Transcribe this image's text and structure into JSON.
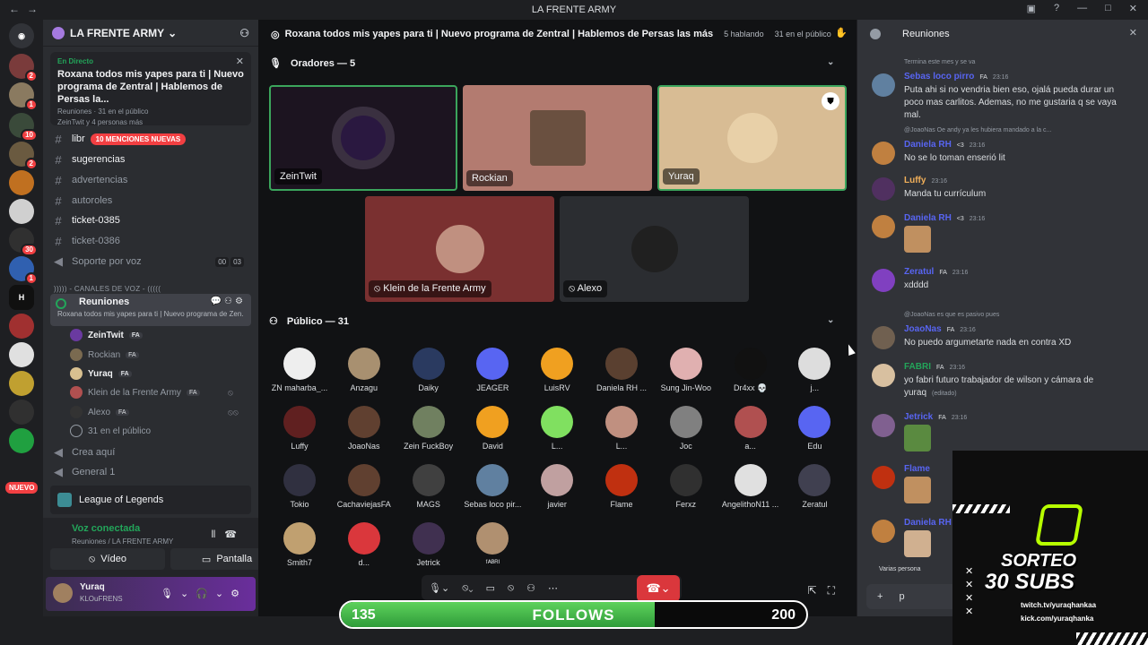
{
  "window": {
    "title": "LA FRENTE ARMY"
  },
  "server": {
    "name": "LA FRENTE ARMY"
  },
  "live_card": {
    "tag": "En Directo",
    "title": "Roxana todos mis yapes para ti | Nuevo programa de Zentral | Hablemos de Persas la...",
    "meta": "Reuniones · 31 en el público",
    "meta2": "ZeinTwit y 4 personas más"
  },
  "channels": [
    {
      "name": "libr",
      "badge": "10 MENCIONES NUEVAS"
    },
    {
      "name": "sugerencias"
    },
    {
      "name": "advertencias"
    },
    {
      "name": "autoroles"
    },
    {
      "name": "ticket-0385"
    },
    {
      "name": "ticket-0386"
    },
    {
      "name": "Soporte por voz",
      "c1": "00",
      "c2": "03"
    }
  ],
  "voice_category": "))))) - CANALES DE VOZ - (((((",
  "voice_room": {
    "name": "Reuniones",
    "desc": "Roxana todos mis yapes para ti | Nuevo programa de Zen..."
  },
  "voice_users": [
    {
      "name": "ZeinTwit",
      "fa": "FA"
    },
    {
      "name": "Rockian",
      "fa": "FA"
    },
    {
      "name": "Yuraq",
      "fa": "FA"
    },
    {
      "name": "Klein de la Frente Army",
      "fa": "FA"
    },
    {
      "name": "Alexo",
      "fa": "FA"
    },
    {
      "name": "31 en el público"
    }
  ],
  "extra_channels": [
    {
      "name": "Crea aquí"
    },
    {
      "name": "General 1"
    }
  ],
  "game": {
    "name": "League of Legends"
  },
  "voice_connected": {
    "status": "Voz conectada",
    "sub": "Reuniones / LA FRENTE ARMY",
    "video": "Vídeo",
    "screen": "Pantalla"
  },
  "user": {
    "name": "Yuraq",
    "status": "KLOuFRENS"
  },
  "nuevo": "NUEVO",
  "stage": {
    "title": "Roxana todos mis yapes para ti | Nuevo programa de Zentral | Hablemos de Persas las más",
    "speaking": "5 hablando",
    "audience_count": "31 en el público",
    "speakers_header": "Oradores — 5",
    "audience_header": "Público — 31",
    "speakers": [
      {
        "name": "ZeinTwit"
      },
      {
        "name": "Rockian"
      },
      {
        "name": "Yuraq"
      },
      {
        "name": "Klein de la Frente Army"
      },
      {
        "name": "Alexo"
      }
    ],
    "audience": [
      "ZN maharba_...",
      "Anzagu",
      "Daiky",
      "JEAGER",
      "LuisRV",
      "Daniela RH ...",
      "Sung Jin-Woo",
      "Dr4xx 💀",
      "j...",
      "Luffy",
      "JoaoNas",
      "Zein FuckBoy",
      "David",
      "L...",
      "L...",
      "Joc",
      "a...",
      "Edu",
      "Tokio",
      "CachaviejasFA",
      "MAGS",
      "Sebas loco pir...",
      "javier",
      "Flame",
      "Ferxz",
      "AngelithoN11 ...",
      "Zeratul",
      "Smith7",
      "d...",
      "Jetrick",
      "ᶠᴬᴮᴿᴵ"
    ]
  },
  "follows": {
    "current": "135",
    "label": "FOLLOWS",
    "goal": "200",
    "progress": 0.675
  },
  "chat": {
    "title": "Reuniones",
    "input": "p",
    "typing": "Varias persona",
    "messages": [
      {
        "reply": "Termina este mes y se va",
        "author": "Sebas loco pirro",
        "tag": "FA",
        "time": "23:16",
        "text": "Puta ahi si no vendria bien eso, ojalá pueda durar un poco mas carlitos. Ademas, no me gustaria q se vaya mal."
      },
      {
        "reply": "@JoaoNas  Oe andy ya les hubiera mandado a la c...",
        "author": "Daniela RH",
        "tag": "<3",
        "time": "23:16",
        "text": "No se lo toman enserió lit"
      },
      {
        "author": "Luffy",
        "time": "23:16",
        "text": "Manda tu currículum"
      },
      {
        "author": "Daniela RH",
        "tag": "<3",
        "time": "23:16",
        "text": ""
      },
      {
        "author": "Zeratul",
        "tag": "FA",
        "time": "23:16",
        "text": "xdddd"
      },
      {
        "reply": "@JoaoNas  es que es pasivo pues",
        "author": "JoaoNas",
        "tag": "FA",
        "time": "23:16",
        "text": "No puedo argumetarte nada en contra XD"
      },
      {
        "author": "FABRI",
        "tag": "FA",
        "time": "23:16",
        "text": "yo  fabri futuro trabajador de wilson y cámara de yuraq",
        "edited": "(editado)"
      },
      {
        "author": "Jetrick",
        "tag": "FA",
        "time": "23:16",
        "text": ""
      },
      {
        "author": "Flame",
        "time": "",
        "text": ""
      },
      {
        "author": "Daniela RH",
        "time": "",
        "text": ""
      }
    ]
  },
  "sorteo": {
    "line1": "SORTEO",
    "line2": "30 SUBS",
    "twitch": "twitch.tv/yuraqhankaa",
    "kick": "kick.com/yuraqhanka"
  },
  "colors": {
    "accent": "#5865f2",
    "green": "#23a55a",
    "red": "#da373c",
    "bg": "#1e1f22"
  }
}
